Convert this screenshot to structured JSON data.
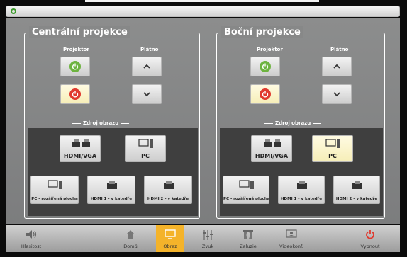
{
  "central": {
    "title": "Centrální projekce",
    "projector_label": "Projektor",
    "screen_label": "Plátno",
    "source_label": "Zdroj obrazu",
    "sources": [
      {
        "label": "HDMI/VGA",
        "icon": "hdmi-vga-icon",
        "selected": true
      },
      {
        "label": "PC",
        "icon": "pc-icon",
        "selected": false
      }
    ],
    "sources_row2": [
      {
        "label": "PC - rozšířená plocha",
        "icon": "pc-icon"
      },
      {
        "label": "HDMI 1 - v katedře",
        "icon": "hdmi-icon"
      },
      {
        "label": "HDMI 2 - v katedře",
        "icon": "hdmi-icon"
      }
    ]
  },
  "side": {
    "title": "Boční projekce",
    "projector_label": "Projektor",
    "screen_label": "Plátno",
    "source_label": "Zdroj obrazu",
    "sources": [
      {
        "label": "HDMI/VGA",
        "icon": "hdmi-vga-icon",
        "selected": false
      },
      {
        "label": "PC",
        "icon": "pc-icon",
        "selected": true
      }
    ],
    "sources_row2": [
      {
        "label": "PC - rozšířená plocha",
        "icon": "pc-icon"
      },
      {
        "label": "HDMI 1 - v katedře",
        "icon": "hdmi-icon"
      },
      {
        "label": "HDMI 2 - v katedře",
        "icon": "hdmi-icon"
      }
    ]
  },
  "nav": {
    "volume": "Hlasitost",
    "home": "Domů",
    "image": "Obraz",
    "sound": "Zvuk",
    "blinds": "Žaluzie",
    "videoconf": "Videokonf.",
    "off": "Vypnout"
  },
  "colors": {
    "power_on": "#6db33f",
    "power_off": "#e03a2f",
    "active_tab": "#f4b32a",
    "selected_source": "#fffbe2"
  }
}
